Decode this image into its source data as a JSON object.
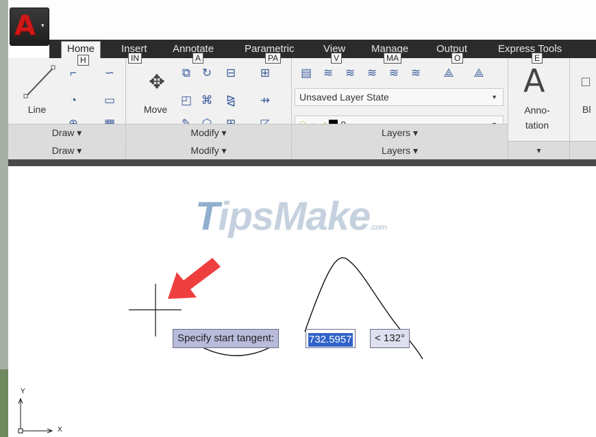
{
  "app_button": {
    "letter": "A",
    "dropdown": "▾"
  },
  "tabs": [
    {
      "label": "Home",
      "key": "H"
    },
    {
      "label": "Insert",
      "key": "IN"
    },
    {
      "label": "Annotate",
      "key": "A"
    },
    {
      "label": "Parametric",
      "key": "PA"
    },
    {
      "label": "View",
      "key": "V"
    },
    {
      "label": "Manage",
      "key": "MA"
    },
    {
      "label": "Output",
      "key": "O"
    },
    {
      "label": "Express Tools",
      "key": "E"
    }
  ],
  "panels": {
    "draw": {
      "footer": "Draw ▾",
      "line_label": "Line"
    },
    "modify": {
      "footer": "Modify ▾",
      "move_label": "Move"
    },
    "layers": {
      "footer": "Layers ▾",
      "layer_state": "Unsaved Layer State",
      "current_layer": "0"
    },
    "annotation": {
      "label_line1": "Anno-",
      "label_line2": "tation",
      "letter": "A",
      "footer": "▾"
    },
    "block": {
      "label": "Bl"
    }
  },
  "watermark": {
    "first": "T",
    "rest": "ipsMake",
    "suffix": ".com"
  },
  "dynamic_input": {
    "prompt": "Specify start tangent:",
    "value": "732.5957",
    "angle": "< 132°"
  },
  "ucs": {
    "x_label": "X",
    "y_label": "Y"
  },
  "colors": {
    "ribbon_bg": "#f1f1f1",
    "tab_bar": "#2b2b2b",
    "prompt_bg": "#b9bbdb",
    "selection": "#2f62c8",
    "arrow": "#ee3b3b"
  }
}
